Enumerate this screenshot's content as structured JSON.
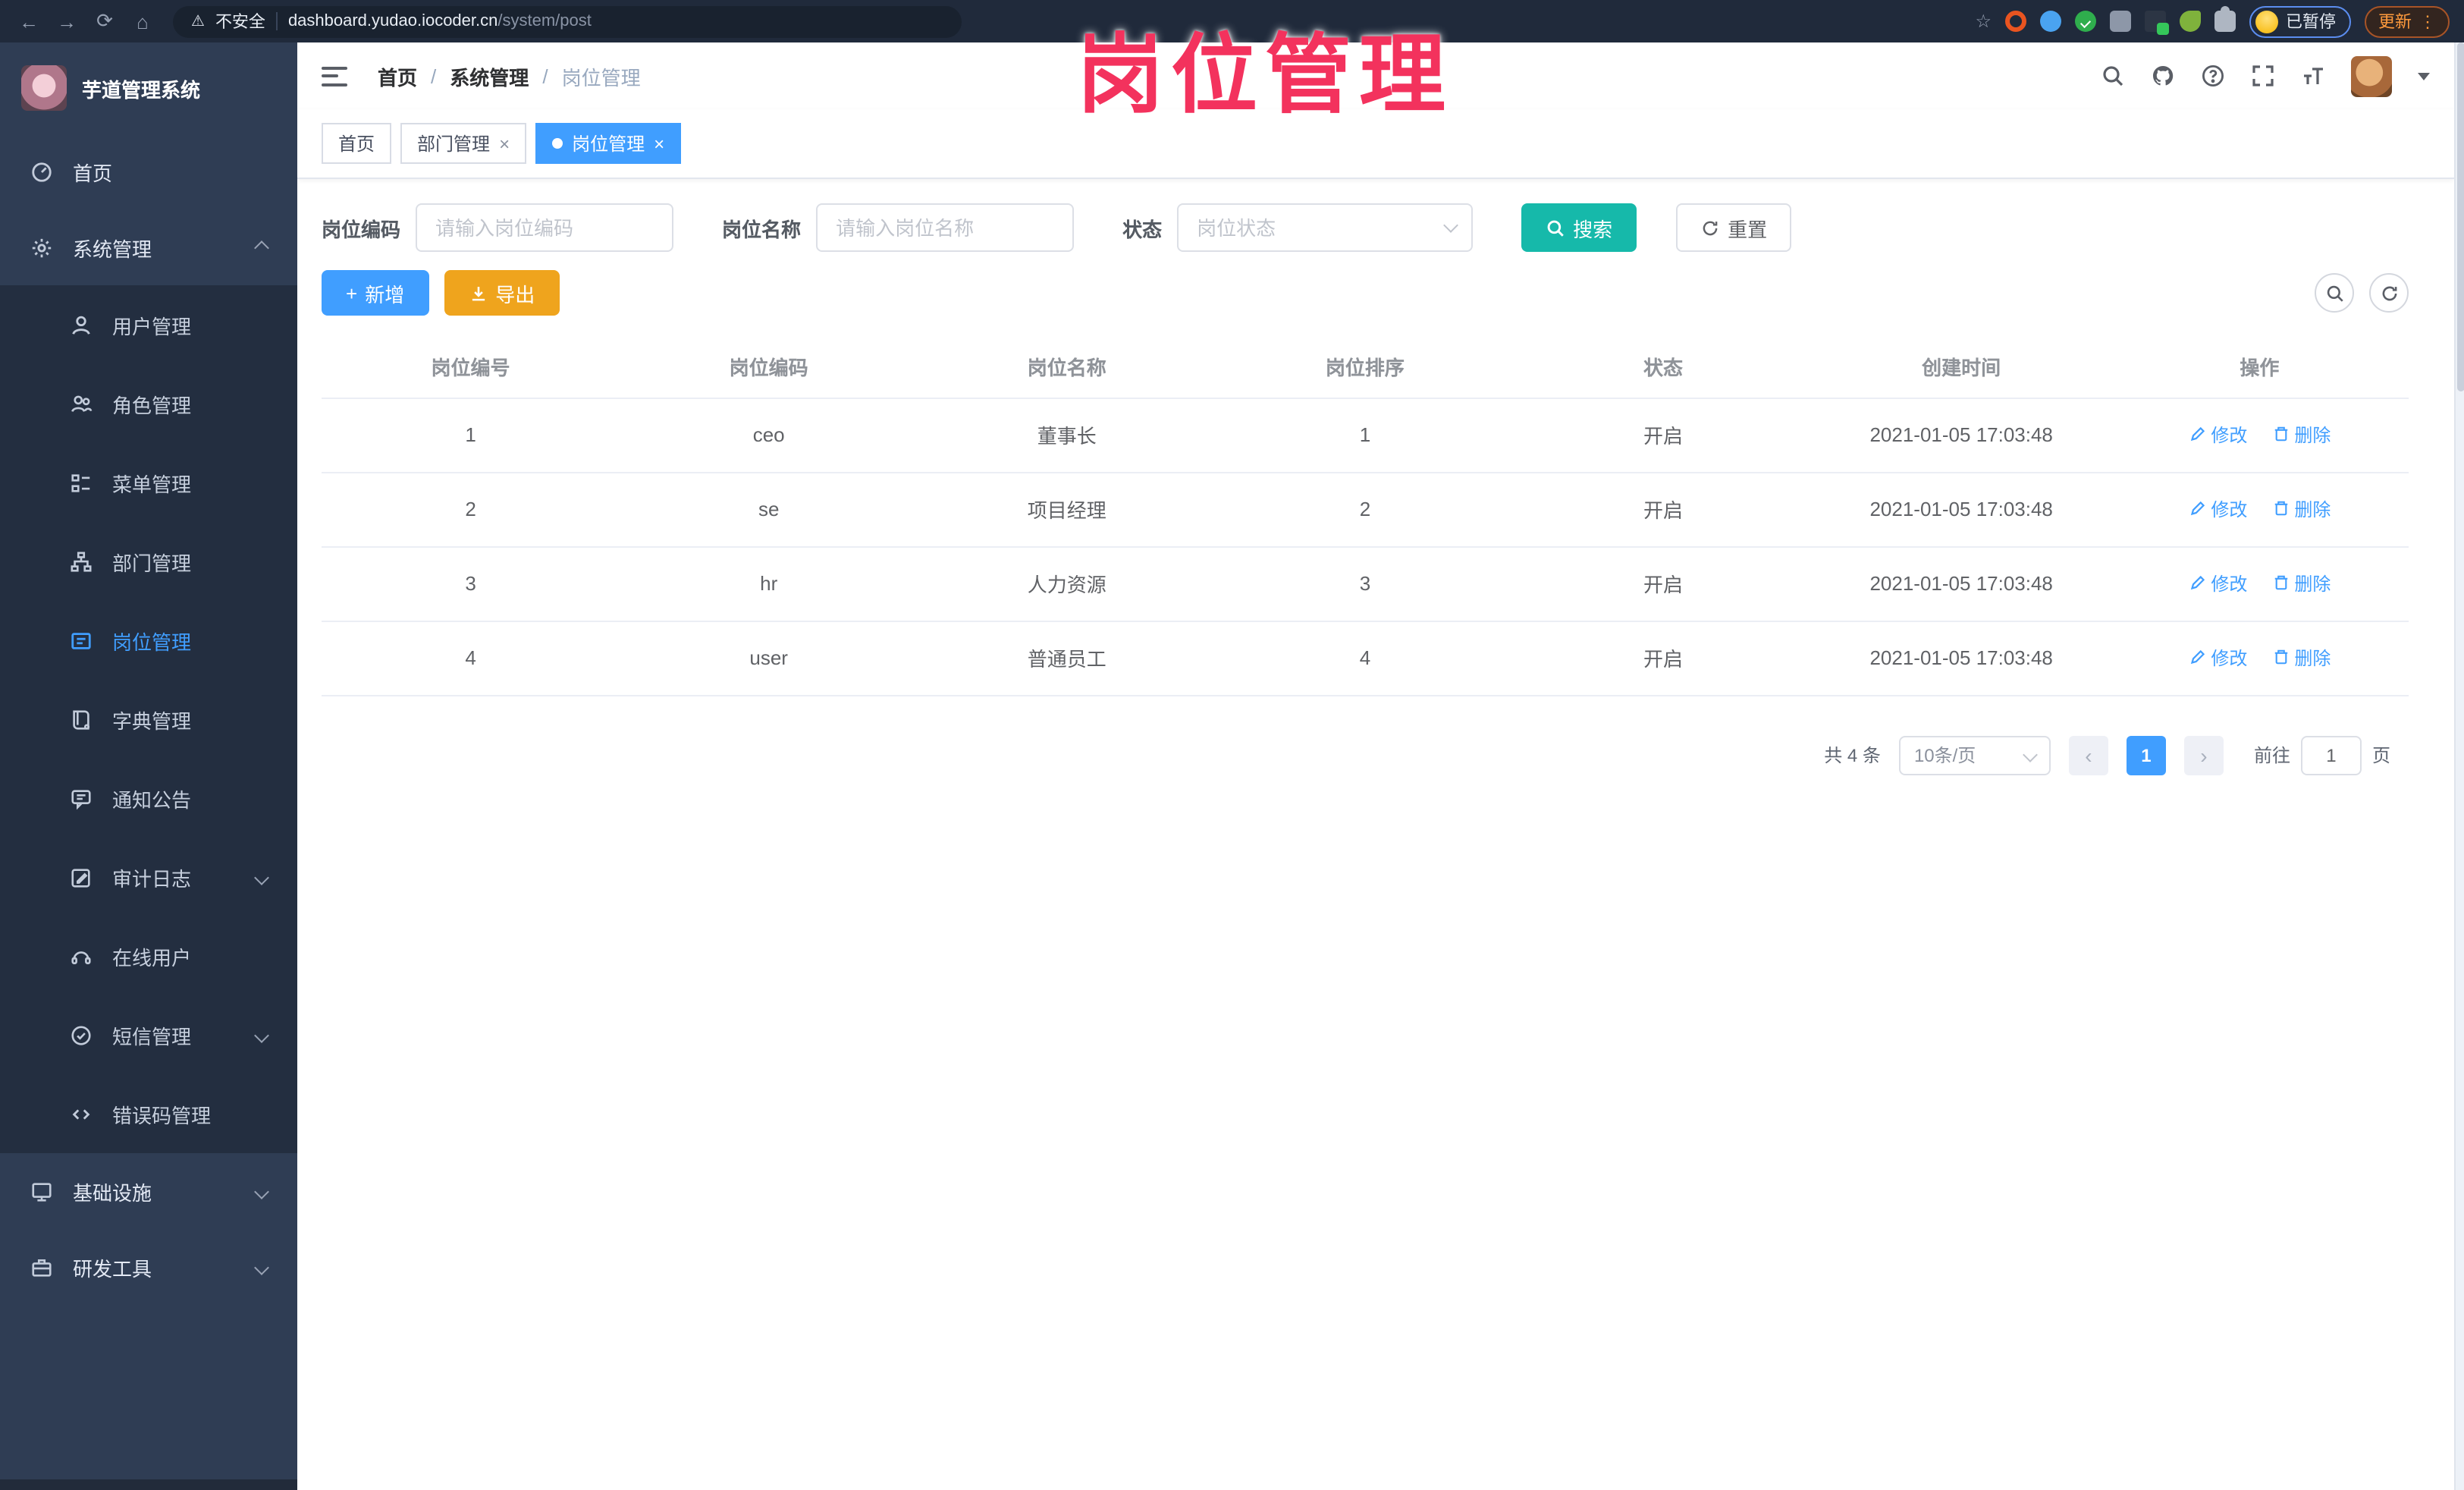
{
  "watermark": "岗位管理",
  "browser": {
    "security": "不安全",
    "domain": "dashboard.yudao.iocoder.cn",
    "path": "/system/post",
    "paused": "已暂停",
    "update": "更新",
    "glyphs": {
      "back": "←",
      "forward": "→",
      "reload": "⟳",
      "home": "⌂",
      "warning": "⚠",
      "star": "☆",
      "dots": "⋮"
    }
  },
  "sidebar": {
    "title": "芋道管理系统",
    "home": "首页",
    "system": "系统管理",
    "system_children": [
      "用户管理",
      "角色管理",
      "菜单管理",
      "部门管理",
      "岗位管理",
      "字典管理",
      "通知公告",
      "审计日志",
      "在线用户",
      "短信管理",
      "错误码管理"
    ],
    "infra": "基础设施",
    "devtools": "研发工具"
  },
  "header": {
    "breadcrumb": [
      "首页",
      "系统管理",
      "岗位管理"
    ],
    "separator": "/"
  },
  "tabs": {
    "items": [
      "首页",
      "部门管理",
      "岗位管理"
    ],
    "close": "×"
  },
  "query": {
    "code_label": "岗位编码",
    "code_placeholder": "请输入岗位编码",
    "name_label": "岗位名称",
    "name_placeholder": "请输入岗位名称",
    "status_label": "状态",
    "status_placeholder": "岗位状态",
    "search": "搜索",
    "reset": "重置"
  },
  "toolbar": {
    "add": "新增",
    "export": "导出",
    "plus": "+"
  },
  "table": {
    "headers": [
      "岗位编号",
      "岗位编码",
      "岗位名称",
      "岗位排序",
      "状态",
      "创建时间",
      "操作"
    ],
    "rows": [
      {
        "id": "1",
        "code": "ceo",
        "name": "董事长",
        "sort": "1",
        "status": "开启",
        "created": "2021-01-05 17:03:48"
      },
      {
        "id": "2",
        "code": "se",
        "name": "项目经理",
        "sort": "2",
        "status": "开启",
        "created": "2021-01-05 17:03:48"
      },
      {
        "id": "3",
        "code": "hr",
        "name": "人力资源",
        "sort": "3",
        "status": "开启",
        "created": "2021-01-05 17:03:48"
      },
      {
        "id": "4",
        "code": "user",
        "name": "普通员工",
        "sort": "4",
        "status": "开启",
        "created": "2021-01-05 17:03:48"
      }
    ],
    "edit": "修改",
    "delete": "删除"
  },
  "pagination": {
    "total": "共 4 条",
    "page_size": "10条/页",
    "prev": "‹",
    "page": "1",
    "next": "›",
    "goto": "前往",
    "goto_value": "1",
    "unit": "页"
  },
  "colors": {
    "accent": "#409eff",
    "search_button": "#16b9aa",
    "export_button": "#efa41d",
    "watermark": "#f3325d",
    "sidebar_bg": "#2f3d54",
    "submenu_bg": "#232e40",
    "active_tab": "#409eff"
  }
}
